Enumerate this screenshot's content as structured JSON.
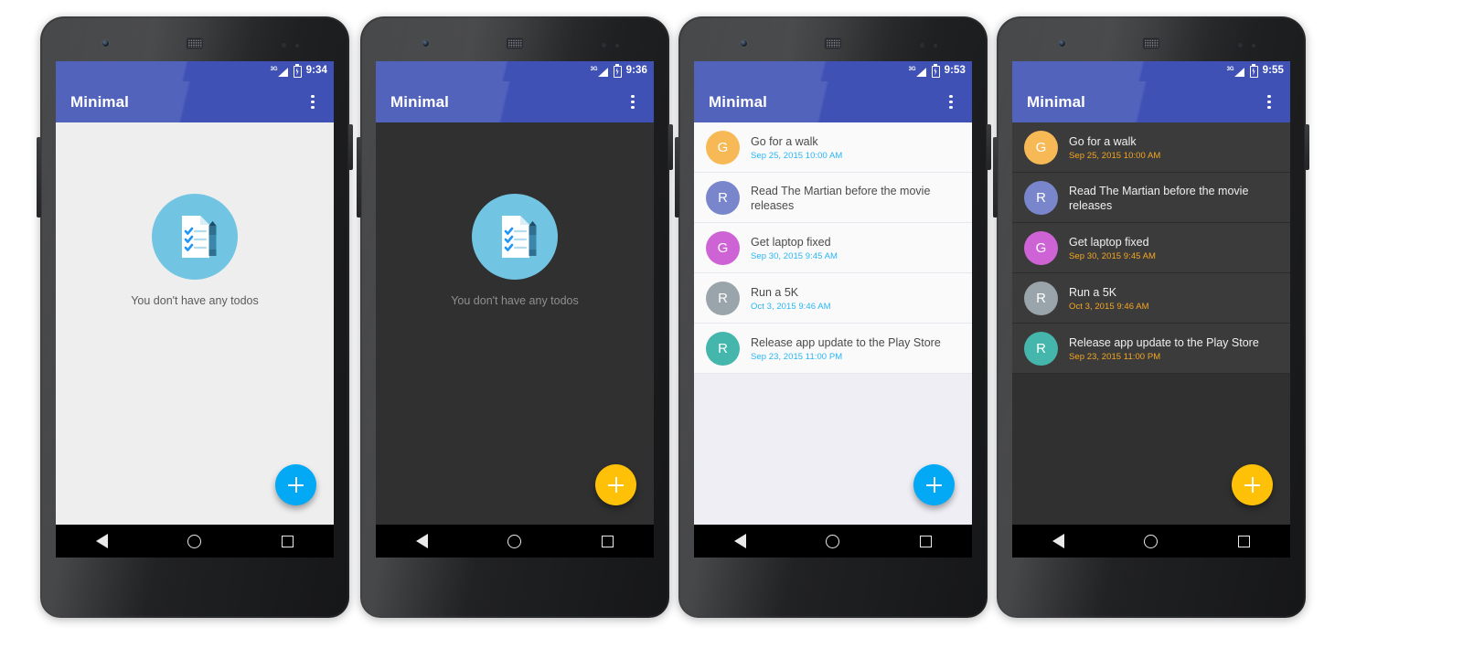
{
  "app": {
    "name": "Minimal",
    "overflow_icon": "overflow-menu-icon"
  },
  "empty_state": {
    "message": "You don't have any todos",
    "illustration": "todo-list-pencil-illustration"
  },
  "fab": {
    "icon": "plus-icon",
    "light_color": "#03a9f4",
    "dark_color": "#ffc107"
  },
  "navbar": {
    "back": "back-triangle-icon",
    "home": "home-circle-icon",
    "recents": "recents-square-icon"
  },
  "statusbar": {
    "network": "3G",
    "signal_icon": "signal-bars-icon",
    "battery_icon": "battery-charging-icon"
  },
  "colors": {
    "primary": "#3f51b5",
    "accent_light": "#03a9f4",
    "accent_dark": "#ffc107",
    "date_light": "#29b6f6",
    "date_dark": "#f5a623",
    "illustration_circle": "#71c5e2"
  },
  "phones": [
    {
      "id": "phone-light-empty",
      "theme": "light",
      "time": "9:34",
      "title": "Minimal",
      "state": "empty",
      "fab_color": "#03a9f4"
    },
    {
      "id": "phone-dark-empty",
      "theme": "dark",
      "time": "9:36",
      "title": "Minimal",
      "state": "empty",
      "fab_color": "#ffc107"
    },
    {
      "id": "phone-light-list",
      "theme": "light",
      "time": "9:53",
      "title": "Minimal",
      "state": "list",
      "fab_color": "#03a9f4"
    },
    {
      "id": "phone-dark-list",
      "theme": "dark",
      "time": "9:55",
      "title": "Minimal",
      "state": "list",
      "fab_color": "#ffc107"
    }
  ],
  "todos": [
    {
      "initial": "G",
      "title": "Go for a walk",
      "date": "Sep 25, 2015  10:00 AM",
      "color": "#f6b martin"
    },
    {
      "initial": "R",
      "title": "Read The Martian before the movie releases",
      "date": "",
      "color": "#7986cb"
    },
    {
      "initial": "G",
      "title": "Get laptop fixed",
      "date": "Sep 30, 2015  9:45 AM",
      "color": "#ce63d6"
    },
    {
      "initial": "R",
      "title": "Run a 5K",
      "date": "Oct 3, 2015  9:46 AM",
      "color": "#9aa4ab"
    },
    {
      "initial": "R",
      "title": "Release app update to the Play Store",
      "date": "Sep 23, 2015  11:00 PM",
      "color": "#45b6ab"
    }
  ],
  "avatar_colors": [
    "#f7b955",
    "#7986cb",
    "#ce63d6",
    "#9aa4ab",
    "#45b6ab"
  ]
}
